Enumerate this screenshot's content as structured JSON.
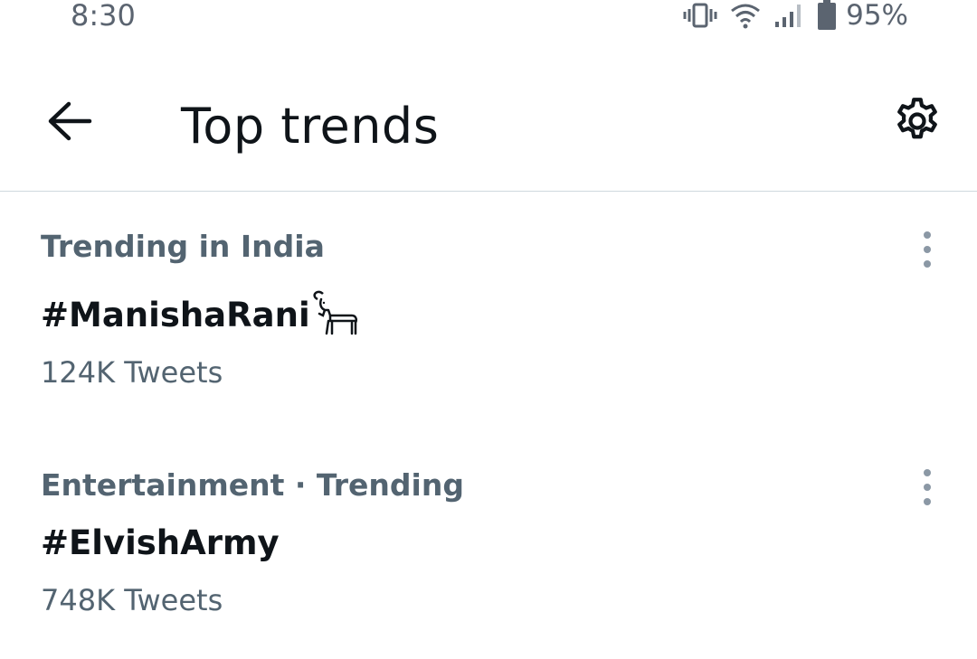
{
  "status_bar": {
    "time": "8:30",
    "battery_percent": "95%",
    "icons": [
      "vibrate-icon",
      "wifi-icon",
      "signal-icon",
      "battery-icon"
    ]
  },
  "header": {
    "title": "Top trends",
    "back_icon": "arrow-left-icon",
    "settings_icon": "gear-icon"
  },
  "trends": [
    {
      "context": "Trending in India",
      "name": "#ManishaRani",
      "emoji_icon": "goat-icon",
      "count": "124K Tweets"
    },
    {
      "context": "Entertainment · Trending",
      "name": "#ElvishArmy",
      "count": "748K Tweets"
    }
  ],
  "colors": {
    "primary_text": "#0f1419",
    "secondary_text": "#536471",
    "divider": "#cfd9de",
    "background": "#ffffff"
  }
}
